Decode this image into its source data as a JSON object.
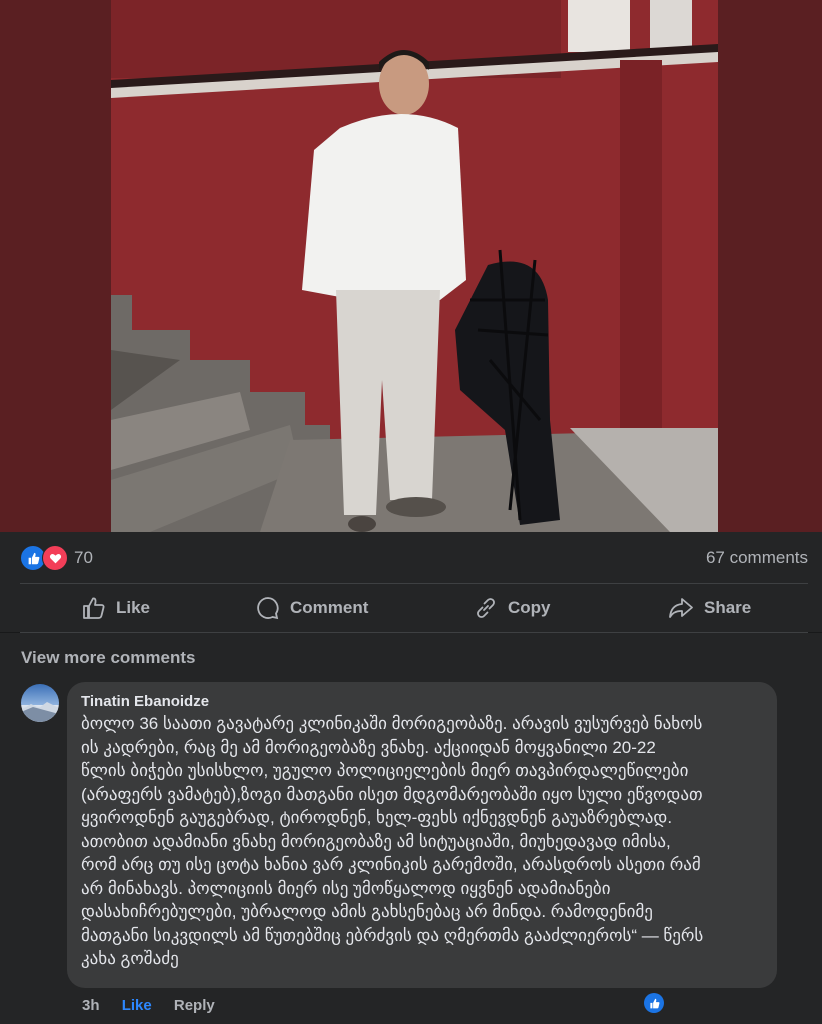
{
  "photo": {
    "description_icon": "post-photo"
  },
  "reactions": {
    "count": "70",
    "comments": "67 comments",
    "icons": [
      "like-icon",
      "love-icon"
    ],
    "colors": {
      "like": "#1b74e4",
      "love": "#f33e58"
    }
  },
  "actions": {
    "like": "Like",
    "comment": "Comment",
    "copy": "Copy",
    "share": "Share"
  },
  "comments": {
    "view_more": "View more comments",
    "items": [
      {
        "author": "Tinatin Ebanoidze",
        "text": "ბოლო 36 საათი გავატარე კლინიკაში მორიგეობაზე. არავის ვუსურვებ ნახოს\nის კადრები, რაც მე ამ მორიგეობაზე ვნახე. აქციიდან მოყვანილი 20-22\nწლის ბიჭები უსისხლო, უგულო პოლიციელების მიერ თავპირდალეწილები\n(არაფერს ვამატებ),ზოგი მათგანი ისეთ მდგომარეობაში იყო სული ეწვოდათ\nყვიროდნენ გაუგებრად, ტიროდნენ, ხელ-ფეხს იქნევდნენ გაუაზრებლად.\nათობით ადამიანი ვნახე მორიგეობაზე ამ სიტუაციაში, მიუხედავად იმისა,\nრომ არც თუ ისე ცოტა ხანია ვარ კლინიკის გარემოში, არასდროს ასეთი რამ\nარ მინახავს. პოლიციის მიერ ისე უმოწყალოდ იყვნენ ადამიანები\nდასახიჩრებულები, უბრალოდ ამის გახსენებაც არ მინდა. რამოდენიმე\nმათგანი სიკვდილს ამ წუთებშიც ებრძვის და ღმერთმა გააძლიეროს“ — წერს\nკახა გოშაძე",
        "time": "3h",
        "like_label": "Like",
        "reply_label": "Reply"
      }
    ]
  }
}
